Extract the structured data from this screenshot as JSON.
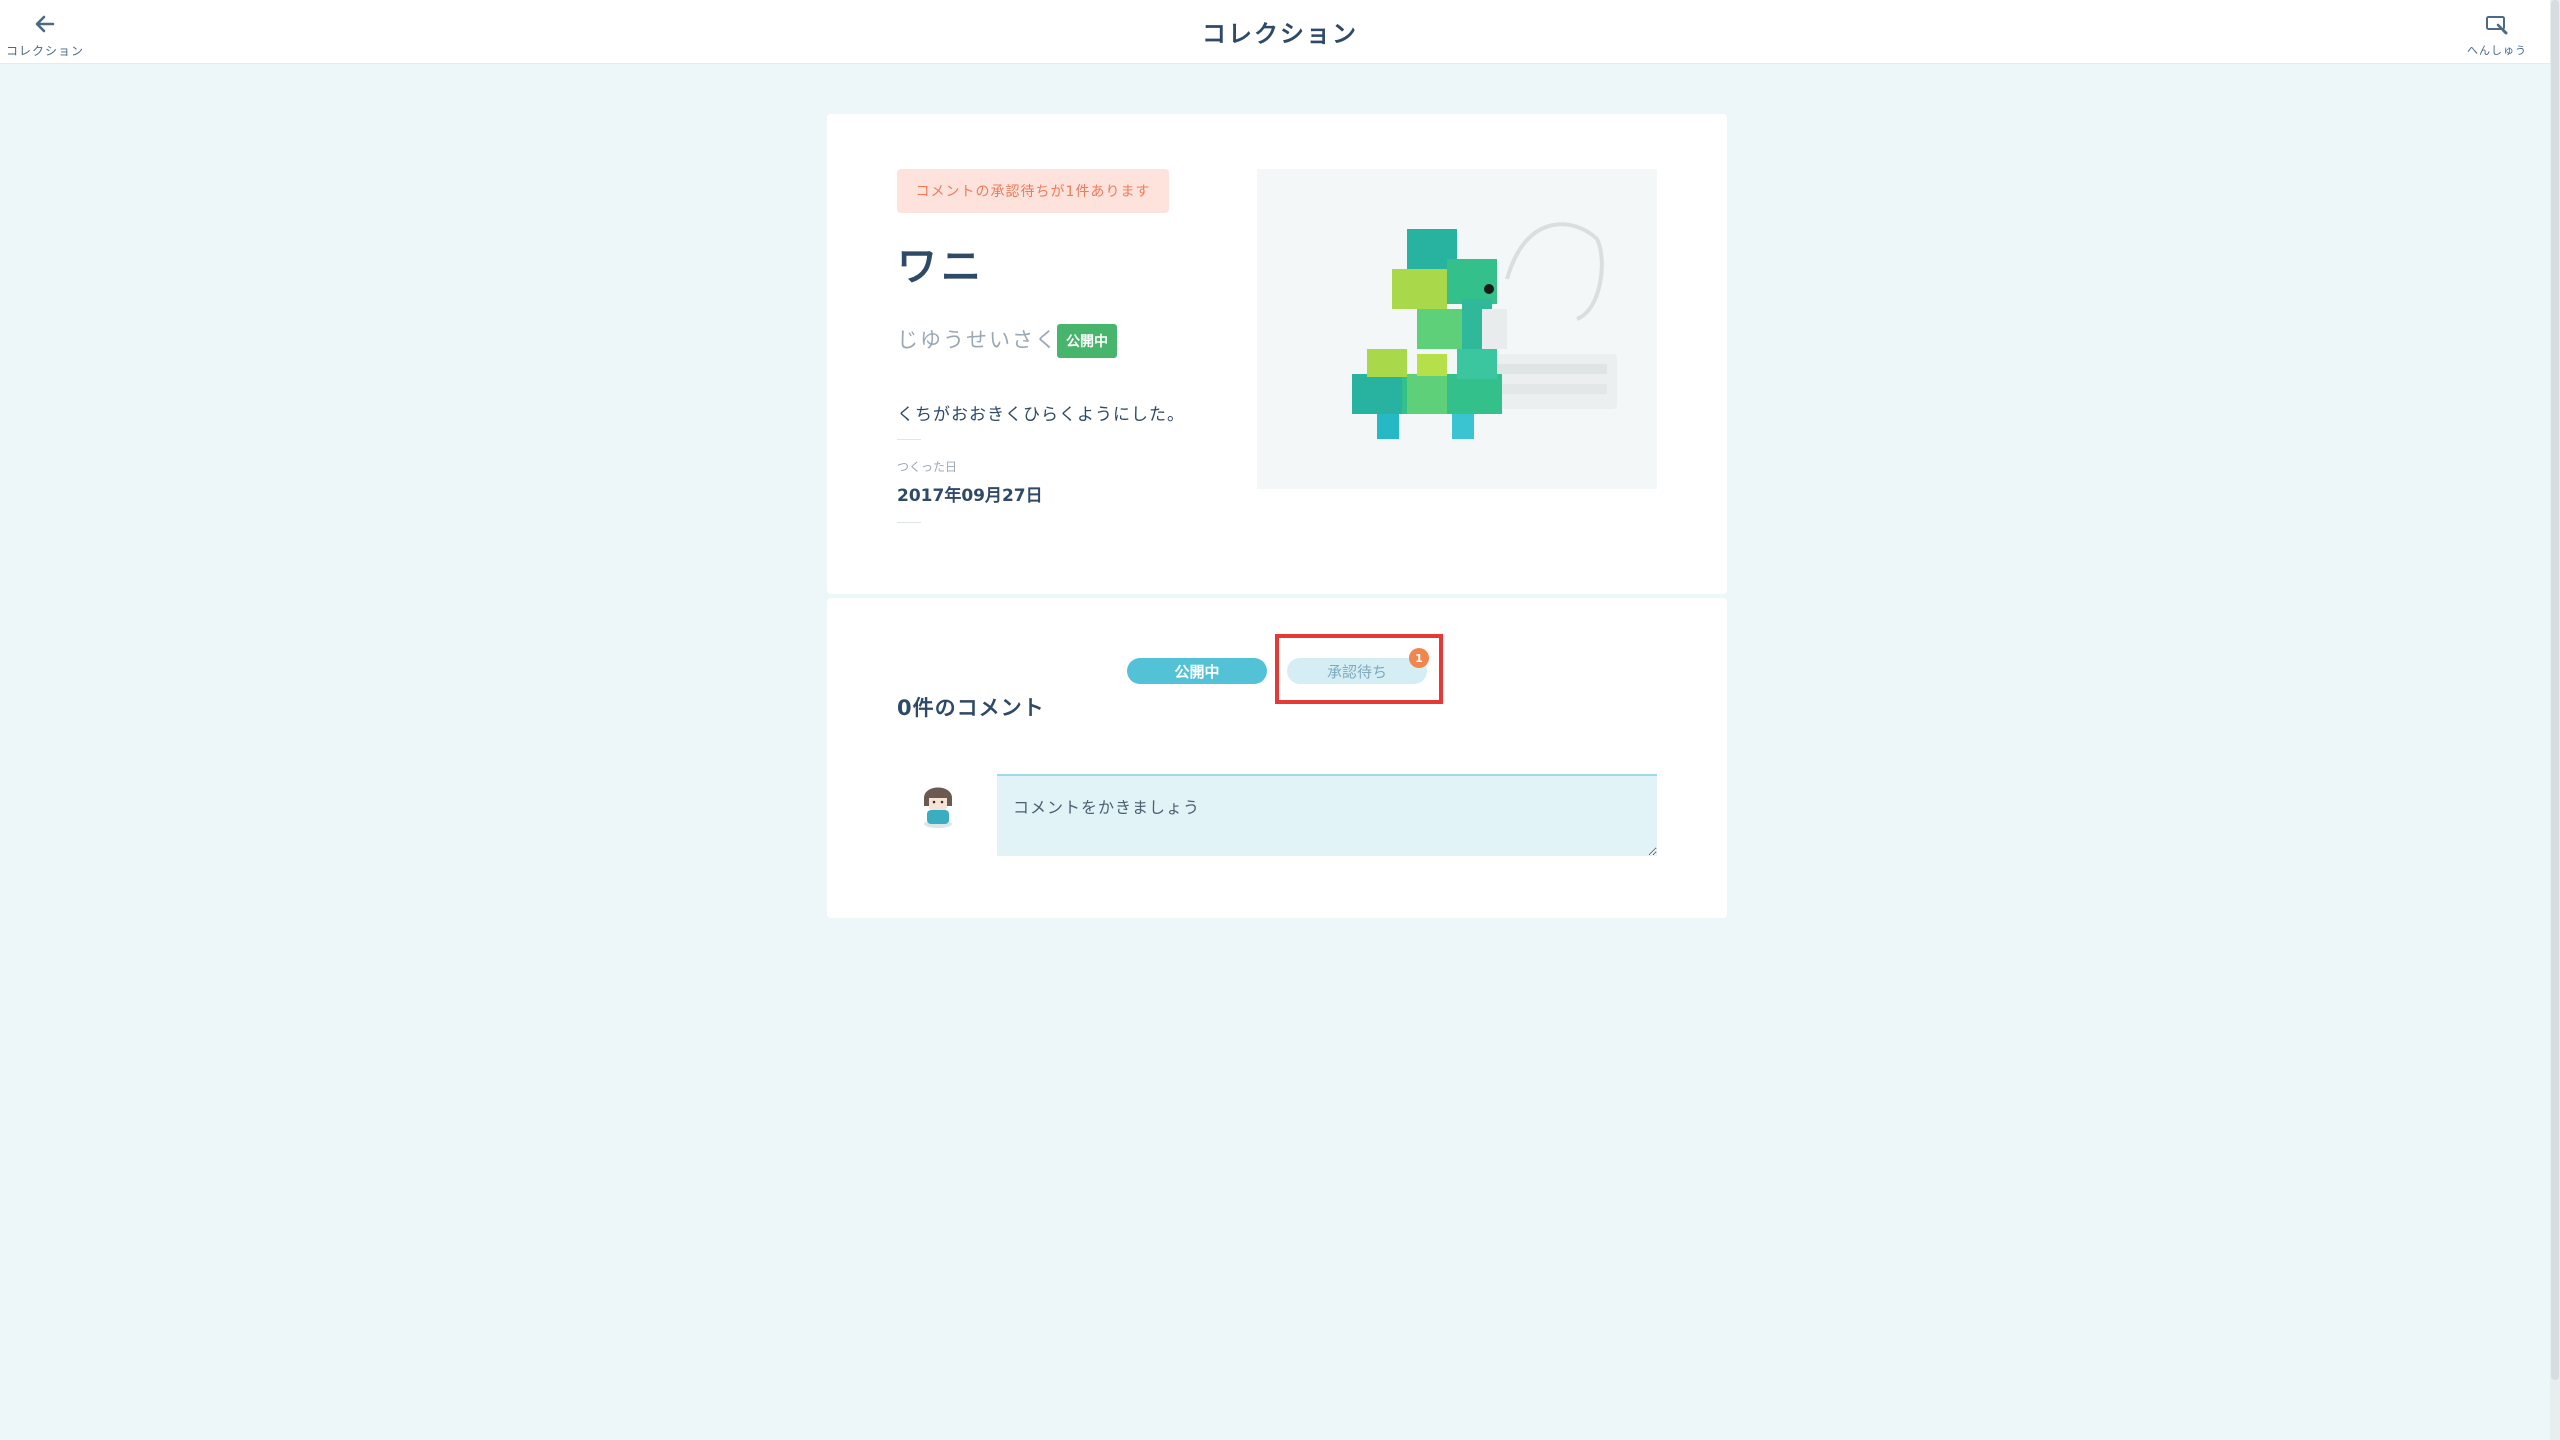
{
  "header": {
    "title": "コレクション",
    "back_label": "コレクション",
    "edit_label": "へんしゅう"
  },
  "work": {
    "pending_notice": "コメントの承認待ちが1件あります",
    "title": "ワニ",
    "category": "じゆうせいさく",
    "status_badge": "公開中",
    "description": "くちがおおきくひらくようにした。",
    "made_label": "つくった日",
    "made_date": "2017年09月27日"
  },
  "comments": {
    "tabs": [
      {
        "label": "公開中",
        "active": true
      },
      {
        "label": "承認待ち",
        "active": false,
        "badge": "1"
      }
    ],
    "count_label": "0件のコメント",
    "input_placeholder": "コメントをかきましょう"
  },
  "colors": {
    "accent": "#53c1d6",
    "public_green": "#47b56b",
    "pending_orange": "#f0854d",
    "highlight_red": "#e53935",
    "background": "#edf6f8"
  },
  "icons": {
    "back": "arrow-left-icon",
    "edit": "edit-icon"
  }
}
